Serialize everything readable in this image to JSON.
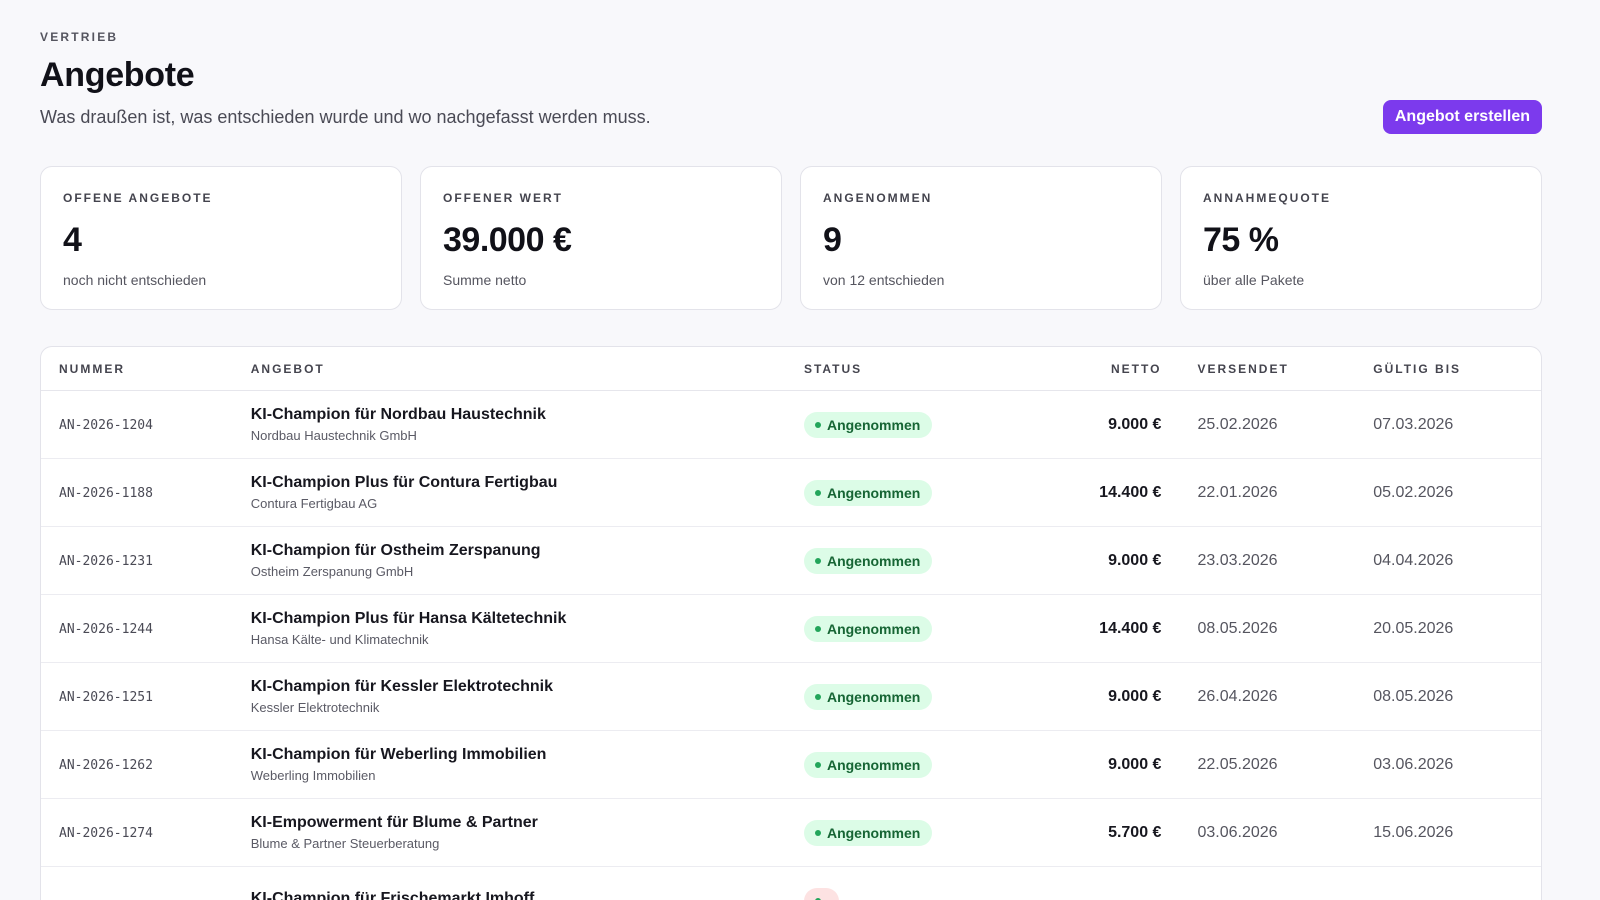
{
  "header": {
    "eyebrow": "VERTRIEB",
    "title": "Angebote",
    "subtitle": "Was draußen ist, was entschieden wurde und wo nachgefasst werden muss.",
    "create_button": "Angebot erstellen"
  },
  "kpis": [
    {
      "label": "OFFENE ANGEBOTE",
      "value": "4",
      "note": "noch nicht entschieden"
    },
    {
      "label": "OFFENER WERT",
      "value": "39.000 €",
      "note": "Summe netto"
    },
    {
      "label": "ANGENOMMEN",
      "value": "9",
      "note": "von 12 entschieden"
    },
    {
      "label": "ANNAHMEQUOTE",
      "value": "75 %",
      "note": "über alle Pakete"
    }
  ],
  "table": {
    "headers": {
      "number": "NUMMER",
      "offer": "ANGEBOT",
      "status": "STATUS",
      "net": "NETTO",
      "sent": "VERSENDET",
      "valid": "GÜLTIG BIS"
    },
    "rows": [
      {
        "number": "AN-2026-1204",
        "title": "KI-Champion für Nordbau Haustechnik",
        "client": "Nordbau Haustechnik GmbH",
        "status": "Angenommen",
        "net": "9.000 €",
        "sent": "25.02.2026",
        "valid": "07.03.2026"
      },
      {
        "number": "AN-2026-1188",
        "title": "KI-Champion Plus für Contura Fertigbau",
        "client": "Contura Fertigbau AG",
        "status": "Angenommen",
        "net": "14.400 €",
        "sent": "22.01.2026",
        "valid": "05.02.2026"
      },
      {
        "number": "AN-2026-1231",
        "title": "KI-Champion für Ostheim Zerspanung",
        "client": "Ostheim Zerspanung GmbH",
        "status": "Angenommen",
        "net": "9.000 €",
        "sent": "23.03.2026",
        "valid": "04.04.2026"
      },
      {
        "number": "AN-2026-1244",
        "title": "KI-Champion Plus für Hansa Kältetechnik",
        "client": "Hansa Kälte- und Klimatechnik",
        "status": "Angenommen",
        "net": "14.400 €",
        "sent": "08.05.2026",
        "valid": "20.05.2026"
      },
      {
        "number": "AN-2026-1251",
        "title": "KI-Champion für Kessler Elektrotechnik",
        "client": "Kessler Elektrotechnik",
        "status": "Angenommen",
        "net": "9.000 €",
        "sent": "26.04.2026",
        "valid": "08.05.2026"
      },
      {
        "number": "AN-2026-1262",
        "title": "KI-Champion für Weberling Immobilien",
        "client": "Weberling Immobilien",
        "status": "Angenommen",
        "net": "9.000 €",
        "sent": "22.05.2026",
        "valid": "03.06.2026"
      },
      {
        "number": "AN-2026-1274",
        "title": "KI-Empowerment für Blume & Partner",
        "client": "Blume & Partner Steuerberatung",
        "status": "Angenommen",
        "net": "5.700 €",
        "sent": "03.06.2026",
        "valid": "15.06.2026"
      },
      {
        "number": "",
        "title": "KI-Champion für Frischemarkt Imhoff",
        "client": "",
        "status": "",
        "net": "",
        "sent": "",
        "valid": "",
        "status_variant": "red"
      }
    ]
  },
  "colors": {
    "accent": "#7c3aed",
    "status_accepted_bg": "#dcfce7",
    "status_accepted_text": "#166534",
    "status_declined_bg": "#fde2e2"
  }
}
